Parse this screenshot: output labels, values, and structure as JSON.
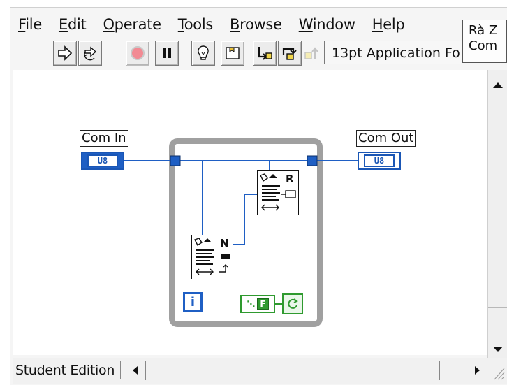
{
  "menu": {
    "items": [
      {
        "label": "File"
      },
      {
        "label": "Edit"
      },
      {
        "label": "Operate"
      },
      {
        "label": "Tools"
      },
      {
        "label": "Browse"
      },
      {
        "label": "Window"
      },
      {
        "label": "Help"
      }
    ]
  },
  "toolbar": {
    "font_ring": "13pt Application Fo",
    "icons": [
      "run-arrow-icon",
      "run-continuously-icon",
      "abort-icon",
      "pause-icon",
      "highlight-execution-icon",
      "retain-wire-values-icon",
      "step-into-icon",
      "step-over-icon"
    ]
  },
  "right_panel": {
    "line1": "Rà Z",
    "line2": "Com"
  },
  "diagram": {
    "com_in_label": "Com In",
    "com_out_label": "Com Out",
    "com_in_type": "U8",
    "com_out_type": "U8",
    "sub_vi_top_letter": "R",
    "sub_vi_bottom_letter": "N",
    "iteration_label": "i",
    "stop_constant": "F"
  },
  "status": {
    "edition": "Student Edition"
  },
  "colors": {
    "wire_blue": "#1f5fc4",
    "loop_border": "#9c9c9c",
    "boolean_green": "#2f9a2f"
  }
}
